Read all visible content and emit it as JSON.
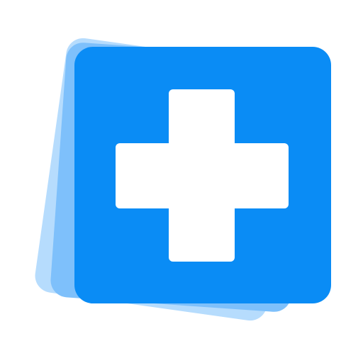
{
  "icon": {
    "name": "medical-cross-icon",
    "colors": {
      "background": "#ffffff",
      "front_card": "#0a8cf5",
      "middle_card": "#7ec0fb",
      "back_card": "#b6dcfd",
      "cross": "#ffffff"
    }
  }
}
